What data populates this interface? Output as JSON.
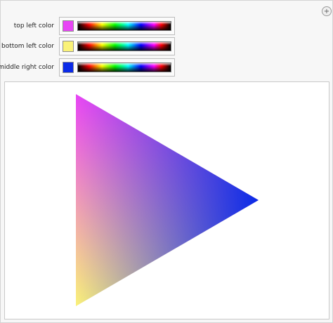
{
  "reset_icon": "plus-icon",
  "reset_symbol": "+",
  "controls": [
    {
      "label": "top left color",
      "color": "#e845f5"
    },
    {
      "label": "bottom left color",
      "color": "#faf278"
    },
    {
      "label": "middle right color",
      "color": "#0a2ae8"
    }
  ]
}
